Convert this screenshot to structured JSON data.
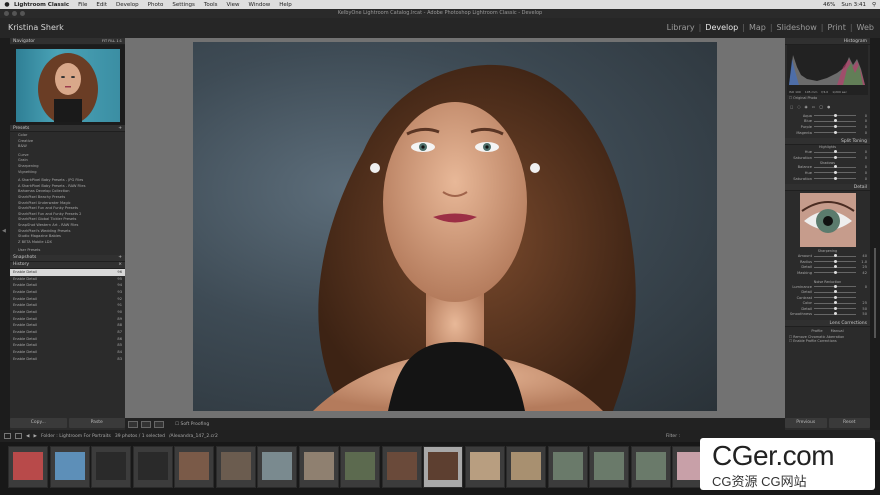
{
  "menubar": {
    "apple": "",
    "app": "Lightroom Classic",
    "items": [
      "File",
      "Edit",
      "Develop",
      "Photo",
      "Settings",
      "Tools",
      "View",
      "Window",
      "Help"
    ],
    "clock": "Sun 3:41",
    "battery": "46%"
  },
  "window": {
    "title": "KelbyOne Lightroom Catalog.lrcat - Adobe Photoshop Lightroom Classic - Develop"
  },
  "identity": {
    "name": "Kristina Sherk",
    "modules": [
      "Library",
      "Develop",
      "Map",
      "Slideshow",
      "Print",
      "Web"
    ],
    "active_module": "Develop"
  },
  "left": {
    "navigator": {
      "title": "Navigator",
      "zoom": [
        "FIT",
        "FILL",
        "1:1"
      ]
    },
    "presets": {
      "title": "Presets",
      "groups": [
        "Color",
        "Creative",
        "B&W",
        "Curve",
        "Grain",
        "Sharpening",
        "Vignetting"
      ],
      "user_groups": [
        "A SharkPixel Baby Presets - JPG Files",
        "A SharkPixel Baby Presets - RAW Files",
        "Bahamas Develop Collection",
        "SharkPixel Beachy Presets",
        "SharkPixel Underwater Magic",
        "SharkPixel Fun and Funky Presets",
        "SharkPixel Fun and Funky Presets 2",
        "SharkPixel Global Tickler Presets",
        "SnapShot Western Art - RAW Files",
        "SharkPixel's Wedding Presets",
        "Studio Magazine Babies",
        "Z BETA Mobile LDX",
        "User Presets"
      ]
    },
    "snapshots": {
      "title": "Snapshots"
    },
    "history": {
      "title": "History",
      "items": [
        {
          "label": "Enable Detail",
          "val": "96"
        },
        {
          "label": "Enable Detail",
          "val": "95"
        },
        {
          "label": "Enable Detail",
          "val": "94"
        },
        {
          "label": "Enable Detail",
          "val": "93"
        },
        {
          "label": "Enable Detail",
          "val": "92"
        },
        {
          "label": "Enable Detail",
          "val": "91"
        },
        {
          "label": "Enable Detail",
          "val": "90"
        },
        {
          "label": "Enable Detail",
          "val": "89"
        },
        {
          "label": "Enable Detail",
          "val": "88"
        },
        {
          "label": "Enable Detail",
          "val": "87"
        },
        {
          "label": "Enable Detail",
          "val": "86"
        },
        {
          "label": "Enable Detail",
          "val": "85"
        },
        {
          "label": "Enable Detail",
          "val": "84"
        },
        {
          "label": "Enable Detail",
          "val": "83"
        }
      ]
    },
    "copy": "Copy...",
    "paste": "Paste"
  },
  "toolbar": {
    "soft_proofing": "Soft Proofing"
  },
  "right": {
    "histogram": {
      "title": "Histogram",
      "meta": [
        "ISO 100",
        "105 mm",
        "f/4.0",
        "1/200 sec"
      ],
      "original": "Original Photo"
    },
    "hsl": {
      "rows": [
        {
          "label": "Aqua",
          "val": "0"
        },
        {
          "label": "Blue",
          "val": "0"
        },
        {
          "label": "Purple",
          "val": "0"
        },
        {
          "label": "Magenta",
          "val": "0"
        }
      ]
    },
    "split": {
      "title": "Split Toning",
      "highlights": "Highlights",
      "shadows": "Shadows",
      "rows": [
        {
          "label": "Hue",
          "val": "0"
        },
        {
          "label": "Saturation",
          "val": "0"
        },
        {
          "label": "Balance",
          "val": "0"
        },
        {
          "label": "Hue",
          "val": "0"
        },
        {
          "label": "Saturation",
          "val": "0"
        }
      ]
    },
    "detail": {
      "title": "Detail",
      "sharpening": "Sharpening",
      "rows": [
        {
          "label": "Amount",
          "val": "40"
        },
        {
          "label": "Radius",
          "val": "1.0"
        },
        {
          "label": "Detail",
          "val": "25"
        },
        {
          "label": "Masking",
          "val": "42"
        }
      ],
      "noise": "Noise Reduction",
      "nrows": [
        {
          "label": "Luminance",
          "val": "0"
        },
        {
          "label": "Detail",
          "val": ""
        },
        {
          "label": "Contrast",
          "val": ""
        },
        {
          "label": "Color",
          "val": "25"
        },
        {
          "label": "Detail",
          "val": "50"
        },
        {
          "label": "Smoothness",
          "val": "50"
        }
      ]
    },
    "lens": {
      "title": "Lens Corrections",
      "tabs": [
        "Profile",
        "Manual"
      ],
      "options": [
        "Remove Chromatic Aberration",
        "Enable Profile Corrections"
      ]
    },
    "previous": "Previous",
    "reset": "Reset"
  },
  "filmstrip": {
    "info": "Folder : Lightroom For Portraits",
    "count": "39 photos / 1 selected",
    "file": "/Alexandra_147_2.cr2",
    "filter": "Filter :",
    "numbers": [
      "",
      "",
      "",
      "",
      "",
      "",
      "",
      "",
      "",
      "19",
      "",
      "",
      "",
      "",
      "",
      "",
      "",
      "",
      "",
      "23",
      "",
      "24",
      "",
      "",
      ""
    ]
  },
  "watermark": {
    "big": "CGer.com",
    "small": "CG资源 CG网站"
  },
  "colors": {
    "accent": "#e6e6e6",
    "panel": "#2b2b2b",
    "background": "#727272"
  }
}
